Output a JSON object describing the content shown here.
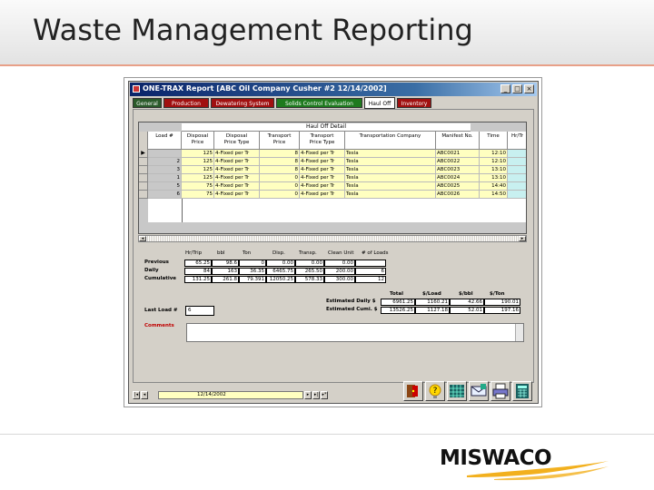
{
  "slide": {
    "title": "Waste Management Reporting"
  },
  "logo": {
    "text": "MISWACO"
  },
  "window": {
    "title": "ONE-TRAX Report [ABC Oil Company  Cusher #2  12/14/2002]",
    "controls": [
      "minimize",
      "maximize",
      "close"
    ]
  },
  "tabs": [
    {
      "label": "General",
      "color": "#2a5a2a"
    },
    {
      "label": "Production",
      "color": "#a01010"
    },
    {
      "label": "Dewatering System",
      "color": "#a01010"
    },
    {
      "label": "Solids Control Evaluation",
      "color": "#1e7a1e"
    },
    {
      "label": "Haul Off",
      "color": "#ffffff",
      "active": true
    },
    {
      "label": "Inventory",
      "color": "#a01010"
    }
  ],
  "grid": {
    "group_title": "Haul Off Detail",
    "columns": [
      "Load #",
      "Disposal\nPrice",
      "Disposal\nPrice Type",
      "Transport\nPrice",
      "Transport\nPrice Type",
      "Transportation Company",
      "Manifest No.",
      "Time",
      "Hr/Tr"
    ],
    "rows": [
      {
        "selector": "▶",
        "load": "",
        "disposal_price": "125",
        "disposal_type": "4-Fixed per Tr",
        "transport_price": "8",
        "transport_type": "4-Fixed per Tr",
        "company": "Tesla",
        "manifest": "ABC0021",
        "time": "12:10"
      },
      {
        "selector": "",
        "load": "2",
        "disposal_price": "125",
        "disposal_type": "4-Fixed per Tr",
        "transport_price": "8",
        "transport_type": "4-Fixed per Tr",
        "company": "Tesla",
        "manifest": "ABC0022",
        "time": "12:10"
      },
      {
        "selector": "",
        "load": "3",
        "disposal_price": "125",
        "disposal_type": "4-Fixed per Tr",
        "transport_price": "8",
        "transport_type": "4-Fixed per Tr",
        "company": "Tesla",
        "manifest": "ABC0023",
        "time": "13:10"
      },
      {
        "selector": "",
        "load": "1",
        "disposal_price": "125",
        "disposal_type": "4-Fixed per Tr",
        "transport_price": "0",
        "transport_type": "4-Fixed per Tr",
        "company": "Tesla",
        "manifest": "ABC0024",
        "time": "13:10"
      },
      {
        "selector": "",
        "load": "5",
        "disposal_price": "75",
        "disposal_type": "4-Fixed per Tr",
        "transport_price": "0",
        "transport_type": "4-Fixed per Tr",
        "company": "Tesla",
        "manifest": "ABC0025",
        "time": "14:40"
      },
      {
        "selector": "",
        "load": "6",
        "disposal_price": "75",
        "disposal_type": "4-Fixed per Tr",
        "transport_price": "0",
        "transport_type": "4-Fixed per Tr",
        "company": "Tesla",
        "manifest": "ABC0026",
        "time": "14:50"
      }
    ]
  },
  "summary": {
    "headers": [
      "Hr/Trip",
      "bbl",
      "Ton",
      "Disp.",
      "Transp.",
      "Clean Unit",
      "# of Loads"
    ],
    "rows": [
      {
        "label": "Previous",
        "values": [
          "65.25",
          "98.6",
          "0",
          "0.00",
          "0.00",
          "0.00",
          ""
        ]
      },
      {
        "label": "Daily",
        "values": [
          "84",
          "163",
          "36.35",
          "6465.75",
          "265.50",
          "200.00",
          "6"
        ]
      },
      {
        "label": "Cumulative",
        "values": [
          "131.25",
          "261.8",
          "79.391",
          "12050.25",
          "578.33",
          "300.00",
          "12"
        ]
      }
    ]
  },
  "last_load": {
    "label": "Last Load #",
    "value": "6"
  },
  "estimates": {
    "headers": [
      "Total",
      "$/Load",
      "$/bbl",
      "$/Ton"
    ],
    "rows": [
      {
        "label": "Estimated Daily $",
        "values": [
          "6961.25",
          "1160.21",
          "42.66",
          "190.01"
        ]
      },
      {
        "label": "Estimated Cumi. $",
        "values": [
          "13526.25",
          "1127.18",
          "52.01",
          "197.16"
        ]
      }
    ]
  },
  "comments": {
    "label": "Comments"
  },
  "nav": {
    "date": "12/14/2002",
    "buttons": [
      "first",
      "previous",
      "next",
      "last",
      "new"
    ]
  },
  "toolbar": {
    "icons": [
      "exit-icon",
      "help-icon",
      "grid-report-icon",
      "email-icon",
      "print-icon",
      "calculator-icon"
    ]
  }
}
